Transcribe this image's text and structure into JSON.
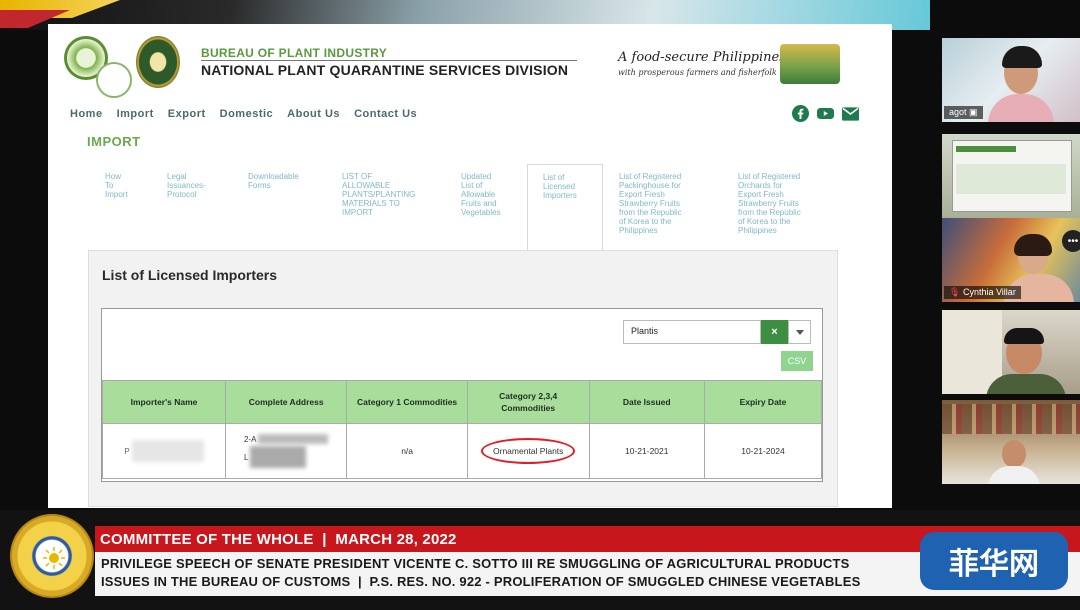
{
  "header": {
    "bureau": "BUREAU OF PLANT INDUSTRY",
    "division": "NATIONAL PLANT QUARANTINE SERVICES DIVISION",
    "tagline_main": "A food-secure Philippines",
    "tagline_sub": "with prosperous farmers and fisherfolk"
  },
  "nav": [
    "Home",
    "Import",
    "Export",
    "Domestic",
    "About Us",
    "Contact Us"
  ],
  "social_icons": [
    "facebook-icon",
    "youtube-icon",
    "email-icon"
  ],
  "section_title": "IMPORT",
  "tabs": [
    "How\nTo\nImport",
    "Legal\nIssuances-\nProtocol",
    "Downloadable\nForms",
    "LIST OF\nALLOWABLE\nPLANTS/PLANTING\nMATERIALS TO\nIMPORT",
    "Updated\nList of\nAllowable\nFruits and\nVegetables",
    "List of\nLicensed\nImporters",
    "List of Registered\nPackinghouse for\nExport Fresh\nStrawberry Fruits\nfrom the Republic\nof Korea to the\nPhilippines",
    "List of Registered\nOrchards for\nExport Fresh\nStrawberry Fruits\nfrom the Republic\nof Korea to the\nPhilippines"
  ],
  "panel": {
    "title": "List of Licensed Importers",
    "search_value": "Plantis",
    "clear_label": "×",
    "csv_label": "CSV",
    "columns": [
      "Importer's Name",
      "Complete Address",
      "Category 1 Commodities",
      "Category 2,3,4\nCommodities",
      "Date Issued",
      "Expiry Date"
    ],
    "row": {
      "name": "P",
      "address_line1": "2-A",
      "address_line2": "L",
      "cat1": "n/a",
      "cat234": "Ornamental Plants",
      "date_issued": "10-21-2021",
      "expiry": "10-21-2024"
    }
  },
  "participants": [
    {
      "name": "agot"
    },
    {
      "name": ""
    },
    {
      "name": "Cynthia Villar"
    },
    {
      "name": ""
    },
    {
      "name": ""
    }
  ],
  "lower_third": {
    "headline": "COMMITTEE OF THE WHOLE  |  MARCH 28, 2022",
    "line1": "PRIVILEGE SPEECH OF SENATE PRESIDENT VICENTE C. SOTTO III RE SMUGGLING OF AGRICULTURAL PRODUCTS",
    "line2": "ISSUES IN THE BUREAU OF CUSTOMS  |  P.S. RES. NO. 922 - PROLIFERATION OF SMUGGLED CHINESE VEGETABLES",
    "seal_text": "SENATE OF THE PHILIPPINES · OFFICIAL SEAL"
  },
  "watermark": "菲华网"
}
